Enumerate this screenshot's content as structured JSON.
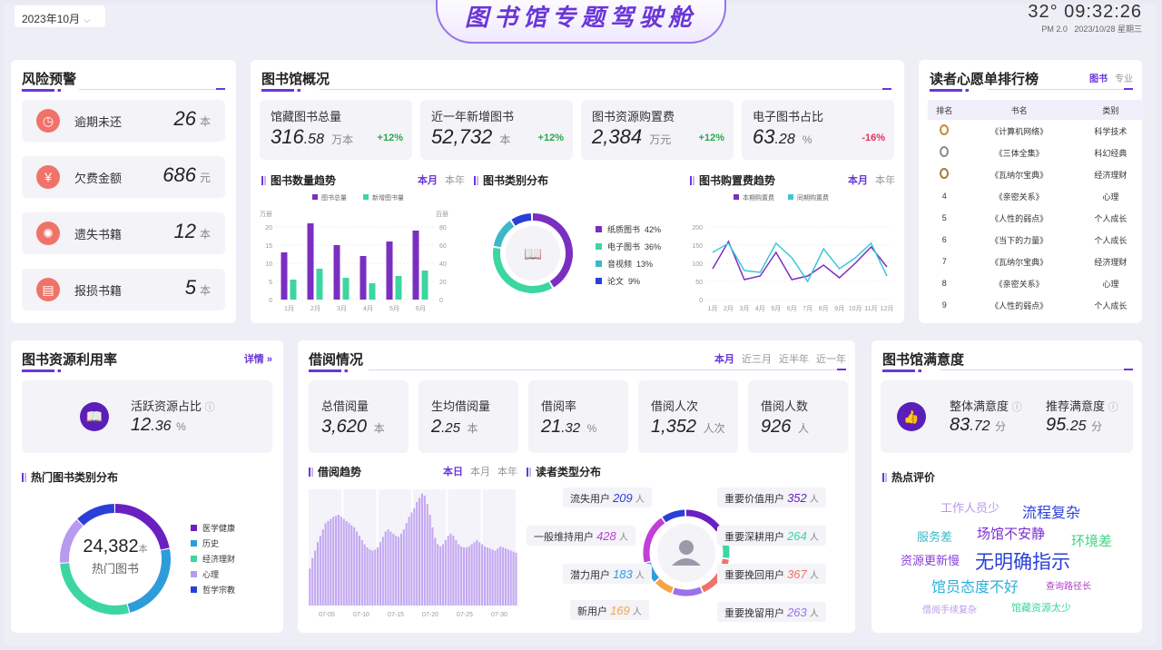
{
  "header": {
    "month": "2023年10月",
    "title": "图书馆专题驾驶舱",
    "temp": "32°",
    "time": "09:32:26",
    "pm": "PM 2.0",
    "date": "2023/10/28",
    "weekday": "星期三"
  },
  "risk": {
    "title": "风险预警",
    "items": [
      {
        "label": "逾期未还",
        "value": "26",
        "unit": "本",
        "color": "#f0736a",
        "icon": "clock-icon"
      },
      {
        "label": "欠费金额",
        "value": "686",
        "unit": "元",
        "color": "#f0736a",
        "icon": "yen-icon"
      },
      {
        "label": "遗失书籍",
        "value": "12",
        "unit": "本",
        "color": "#f0736a",
        "icon": "lost-icon"
      },
      {
        "label": "报损书籍",
        "value": "5",
        "unit": "本",
        "color": "#f0736a",
        "icon": "damage-icon"
      }
    ]
  },
  "overview": {
    "title": "图书馆概况",
    "cards": [
      {
        "label": "馆藏图书总量",
        "value": "316",
        "dec": ".58",
        "unit": "万本",
        "pct": "+12%",
        "up": true
      },
      {
        "label": "近一年新增图书",
        "value": "52,732",
        "dec": "",
        "unit": "本",
        "pct": "+12%",
        "up": true
      },
      {
        "label": "图书资源购置费",
        "value": "2,384",
        "dec": "",
        "unit": "万元",
        "pct": "+12%",
        "up": true
      },
      {
        "label": "电子图书占比",
        "value": "63",
        "dec": ".28",
        "unit": "%",
        "pct": "-16%",
        "up": false
      }
    ],
    "trend_title": "图书数量趋势",
    "trend_tabs": [
      "本月",
      "本年"
    ],
    "cat_title": "图书类别分布",
    "cost_title": "图书购置费趋势",
    "cost_tabs": [
      "本月",
      "本年"
    ]
  },
  "wishlist": {
    "title": "读者心愿单排行榜",
    "tabs": [
      "图书",
      "专业"
    ],
    "headers": [
      "排名",
      "书名",
      "类别"
    ],
    "rows": [
      {
        "rank": "1",
        "name": "《计算机网络》",
        "cat": "科学技术"
      },
      {
        "rank": "2",
        "name": "《三体全集》",
        "cat": "科幻经典"
      },
      {
        "rank": "3",
        "name": "《瓦纳尔宝典》",
        "cat": "经济理财"
      },
      {
        "rank": "4",
        "name": "《亲密关系》",
        "cat": "心理"
      },
      {
        "rank": "5",
        "name": "《人性的弱点》",
        "cat": "个人成长"
      },
      {
        "rank": "6",
        "name": "《当下的力量》",
        "cat": "个人成长"
      },
      {
        "rank": "7",
        "name": "《瓦纳尔宝典》",
        "cat": "经济理财"
      },
      {
        "rank": "8",
        "name": "《亲密关系》",
        "cat": "心理"
      },
      {
        "rank": "9",
        "name": "《人性的弱点》",
        "cat": "个人成长"
      }
    ]
  },
  "utilization": {
    "title": "图书资源利用率",
    "detail": "详情 »",
    "active_label": "活跃资源占比",
    "active_value": "12",
    "active_dec": ".36",
    "active_unit": "%",
    "hot_title": "热门图书类别分布",
    "hot_total": "24,382",
    "hot_unit": "本",
    "hot_label": "热门图书",
    "hot_legend": [
      {
        "name": "医学健康",
        "color": "#6a1fc0"
      },
      {
        "name": "历史",
        "color": "#2d9cdb"
      },
      {
        "name": "经济理财",
        "color": "#3cd6a0"
      },
      {
        "name": "心理",
        "color": "#b89af0"
      },
      {
        "name": "哲学宗教",
        "color": "#2a3fd8"
      }
    ]
  },
  "borrow": {
    "title": "借阅情况",
    "tabs": [
      "本月",
      "近三月",
      "近半年",
      "近一年"
    ],
    "cards": [
      {
        "label": "总借阅量",
        "value": "3,620",
        "dec": "",
        "unit": "本"
      },
      {
        "label": "生均借阅量",
        "value": "2",
        "dec": ".25",
        "unit": "本"
      },
      {
        "label": "借阅率",
        "value": "21",
        "dec": ".32",
        "unit": "%"
      },
      {
        "label": "借阅人次",
        "value": "1,352",
        "dec": "",
        "unit": "人次"
      },
      {
        "label": "借阅人数",
        "value": "926",
        "dec": "",
        "unit": "人"
      }
    ],
    "trend_title": "借阅趋势",
    "trend_tabs": [
      "本日",
      "本月",
      "本年"
    ],
    "reader_title": "读者类型分布",
    "readers_left": [
      {
        "label": "流失用户",
        "value": "209",
        "unit": "人",
        "color": "#2a3fd8"
      },
      {
        "label": "一般维持用户",
        "value": "428",
        "unit": "人",
        "color": "#c23ed8"
      },
      {
        "label": "潜力用户",
        "value": "183",
        "unit": "人",
        "color": "#2d9cdb"
      },
      {
        "label": "新用户",
        "value": "169",
        "unit": "人",
        "color": "#f5a445"
      }
    ],
    "readers_right": [
      {
        "label": "重要价值用户",
        "value": "352",
        "unit": "人",
        "color": "#6a1fc0"
      },
      {
        "label": "重要深耕用户",
        "value": "264",
        "unit": "人",
        "color": "#3cd6a0"
      },
      {
        "label": "重要挽回用户",
        "value": "367",
        "unit": "人",
        "color": "#f0736a"
      },
      {
        "label": "重要挽留用户",
        "value": "263",
        "unit": "人",
        "color": "#9b72e8"
      }
    ]
  },
  "satisfaction": {
    "title": "图书馆满意度",
    "overall_label": "整体满意度",
    "overall_value": "83",
    "overall_dec": ".72",
    "overall_unit": "分",
    "recommend_label": "推荐满意度",
    "recommend_value": "95",
    "recommend_dec": ".25",
    "recommend_unit": "分",
    "hot_title": "热点评价",
    "words": [
      {
        "text": "工作人员少",
        "color": "#b89af0",
        "size": 13
      },
      {
        "text": "流程复杂",
        "color": "#2a3fd8",
        "size": 16
      },
      {
        "text": "服务差",
        "color": "#3cb8c8",
        "size": 13
      },
      {
        "text": "场馆不安静",
        "color": "#7a2fd0",
        "size": 15
      },
      {
        "text": "环境差",
        "color": "#3cd680",
        "size": 15
      },
      {
        "text": "资源更新慢",
        "color": "#8a3fd8",
        "size": 13
      },
      {
        "text": "无明确指示",
        "color": "#2a3fd8",
        "size": 21
      },
      {
        "text": "馆员态度不好",
        "color": "#2db0d8",
        "size": 16
      },
      {
        "text": "查询路径长",
        "color": "#b040c8",
        "size": 10
      },
      {
        "text": "借阅手续复杂",
        "color": "#b89af0",
        "size": 10
      },
      {
        "text": "馆藏资源太少",
        "color": "#3cd6a0",
        "size": 11
      }
    ]
  },
  "chart_data": [
    {
      "type": "bar",
      "title": "图书数量趋势",
      "ylabel": "万册",
      "y2label": "百册",
      "categories": [
        "1月",
        "2月",
        "3月",
        "4月",
        "5月",
        "6月"
      ],
      "ylim": [
        0,
        20
      ],
      "y2lim": [
        0,
        80
      ],
      "series": [
        {
          "name": "图书总量",
          "color": "#7a2fc0",
          "values": [
            13,
            21,
            15,
            12,
            16,
            19
          ]
        },
        {
          "name": "新增图书量",
          "color": "#3cd6a0",
          "values": [
            5.5,
            8.5,
            6,
            4.5,
            6.5,
            8
          ]
        }
      ]
    },
    {
      "type": "pie",
      "title": "图书类别分布",
      "slices": [
        {
          "name": "纸质图书",
          "value": 42,
          "color": "#7a2fc0",
          "label": "42%"
        },
        {
          "name": "电子图书",
          "value": 36,
          "color": "#3cd6a0",
          "label": "36%"
        },
        {
          "name": "音视频",
          "value": 13,
          "color": "#3cb8c8",
          "label": "13%"
        },
        {
          "name": "论文",
          "value": 9,
          "color": "#2a3fd8",
          "label": "9%"
        }
      ]
    },
    {
      "type": "line",
      "title": "图书购置费趋势",
      "categories": [
        "1月",
        "2月",
        "3月",
        "4月",
        "5月",
        "6月",
        "7月",
        "8月",
        "9月",
        "10月",
        "11月",
        "12月"
      ],
      "ylim": [
        0,
        200
      ],
      "series": [
        {
          "name": "本期购置费",
          "color": "#7a2fc0",
          "values": [
            85,
            160,
            55,
            65,
            130,
            55,
            65,
            95,
            60,
            100,
            145,
            90
          ]
        },
        {
          "name": "同期购置费",
          "color": "#3cc8d8",
          "values": [
            130,
            155,
            80,
            75,
            155,
            115,
            50,
            140,
            85,
            115,
            155,
            65
          ]
        }
      ]
    },
    {
      "type": "bar",
      "title": "借阅趋势",
      "x_ticks": [
        "07-05",
        "07-10",
        "07-15",
        "07-20",
        "07-25",
        "07-30"
      ],
      "values": [
        35,
        45,
        52,
        60,
        66,
        72,
        78,
        80,
        82,
        84,
        85,
        86,
        84,
        82,
        80,
        78,
        76,
        74,
        70,
        66,
        62,
        58,
        55,
        53,
        52,
        53,
        55,
        60,
        65,
        70,
        72,
        70,
        68,
        66,
        65,
        68,
        72,
        78,
        84,
        88,
        92,
        98,
        102,
        106,
        104,
        96,
        86,
        74,
        64,
        58,
        56,
        58,
        62,
        66,
        68,
        66,
        62,
        58,
        56,
        55,
        55,
        56,
        58,
        60,
        62,
        60,
        58,
        56,
        55,
        54,
        53,
        52,
        54,
        56,
        55,
        54,
        53,
        52,
        51,
        50
      ]
    },
    {
      "type": "pie",
      "title": "热门图书类别分布",
      "slices": [
        {
          "name": "医学健康",
          "value": 22,
          "color": "#6a1fc0"
        },
        {
          "name": "历史",
          "value": 24,
          "color": "#2d9cdb"
        },
        {
          "name": "经济理财",
          "value": 28,
          "color": "#3cd6a0"
        },
        {
          "name": "心理",
          "value": 14,
          "color": "#b89af0"
        },
        {
          "name": "哲学宗教",
          "value": 12,
          "color": "#2a3fd8"
        }
      ]
    }
  ]
}
